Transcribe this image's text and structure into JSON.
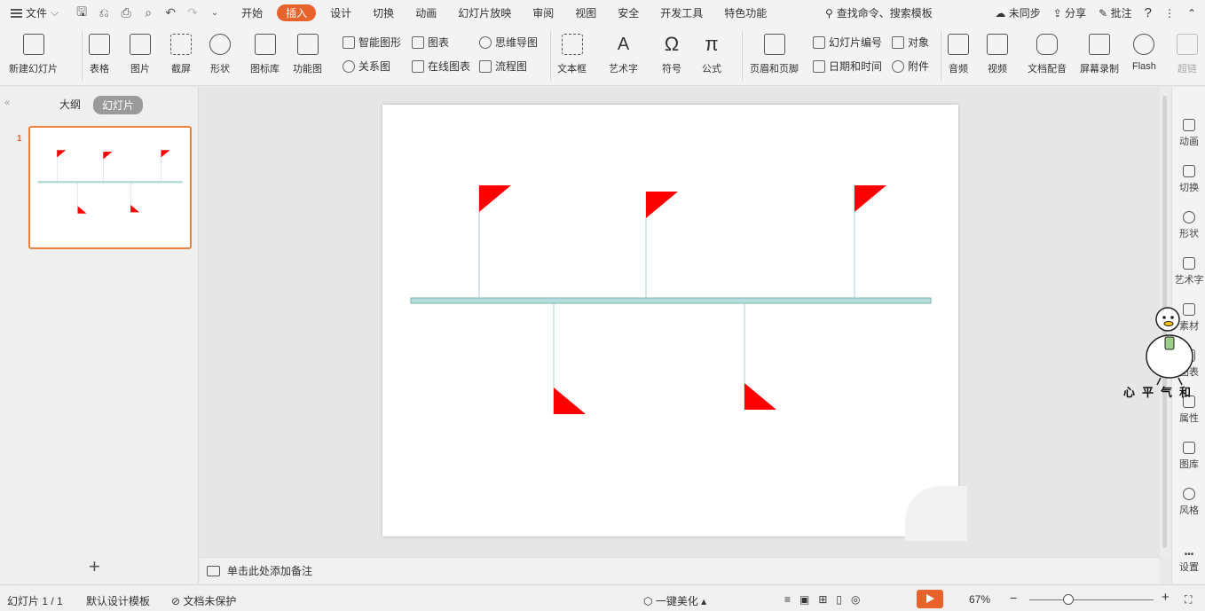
{
  "menubar": {
    "file_label": "文件",
    "tabs": [
      "开始",
      "插入",
      "设计",
      "切换",
      "动画",
      "幻灯片放映",
      "审阅",
      "视图",
      "安全",
      "开发工具",
      "特色功能"
    ],
    "search_text": "查找命令、搜索模板",
    "sync_label": "未同步",
    "share_label": "分享",
    "comment_label": "批注"
  },
  "ribbon": {
    "new_slide": "新建幻灯片",
    "table": "表格",
    "picture": "图片",
    "screenshot": "截屏",
    "shape": "形状",
    "icon_lib": "图标库",
    "func_chart": "功能图",
    "smart_art": "智能图形",
    "chart": "图表",
    "mind_map": "思维导图",
    "relation": "关系图",
    "online_chart": "在线图表",
    "flowchart": "流程图",
    "textbox": "文本框",
    "art_text": "艺术字",
    "symbol": "符号",
    "formula": "公式",
    "header_footer": "页眉和页脚",
    "slide_number": "幻灯片编号",
    "object": "对象",
    "datetime": "日期和时间",
    "attachment": "附件",
    "audio": "音频",
    "video": "视频",
    "doc_dub": "文档配音",
    "screen_rec": "屏幕录制",
    "flash": "Flash",
    "hyperlink": "超链"
  },
  "left_panel": {
    "outline_tab": "大纲",
    "slides_tab": "幻灯片",
    "slide_number": "1",
    "add_icon": "+"
  },
  "right_bar": [
    "动画",
    "切换",
    "形状",
    "艺术字",
    "素材",
    "图表",
    "属性",
    "图库",
    "风格",
    "设置"
  ],
  "notes": {
    "placeholder": "单击此处添加备注"
  },
  "status": {
    "slide_count": "幻灯片 1 / 1",
    "template": "默认设计模板",
    "protection": "文档未保护",
    "beautify": "一键美化",
    "zoom": "67%"
  },
  "mascot": {
    "text": "心平气和"
  },
  "colors": {
    "accent": "#e8632c",
    "flag": "#ff0000",
    "timeline": "#b2dfdb"
  },
  "slide_content": {
    "top_flags": 3,
    "bottom_flags": 2
  }
}
